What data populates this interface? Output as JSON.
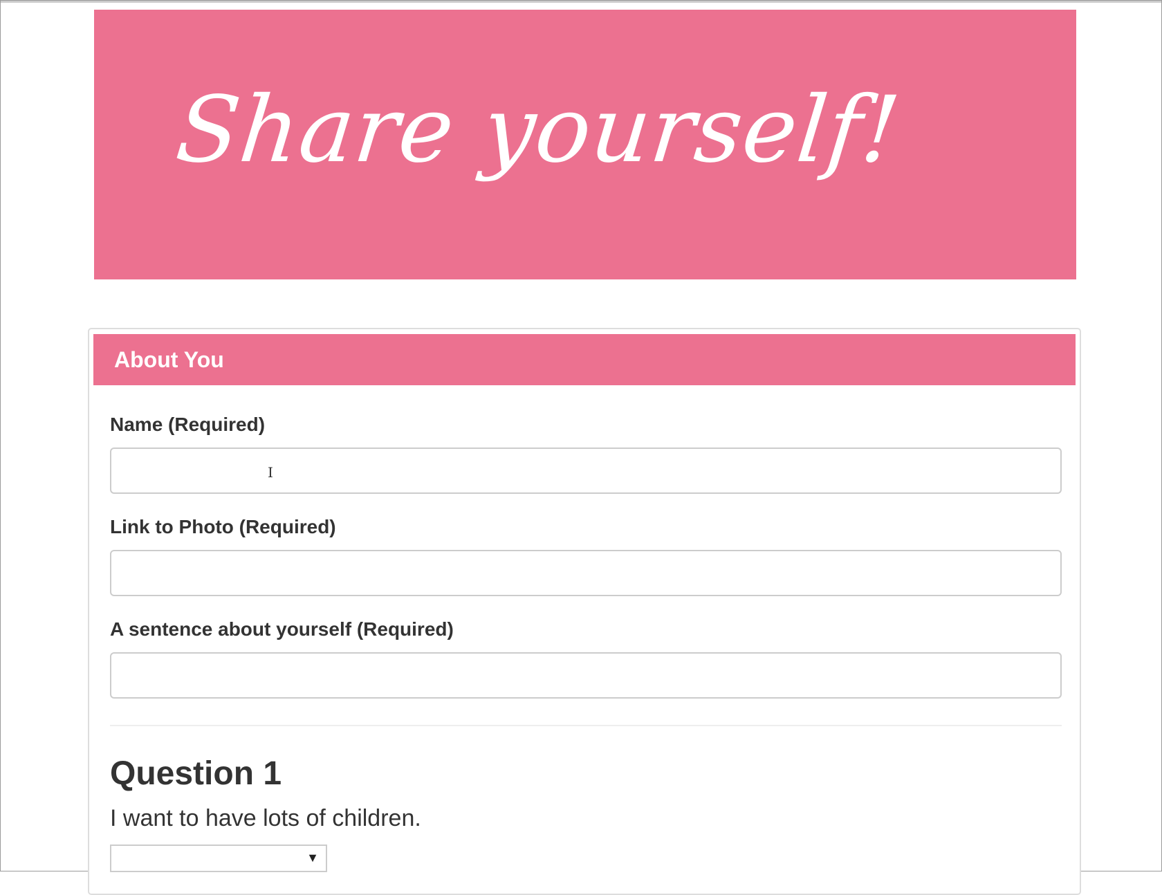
{
  "hero": {
    "title": "Share yourself!"
  },
  "section": {
    "heading": "About You"
  },
  "fields": {
    "name": {
      "label": "Name (Required)",
      "value": ""
    },
    "photo": {
      "label": "Link to Photo (Required)",
      "value": ""
    },
    "sentence": {
      "label": "A sentence about yourself (Required)",
      "value": ""
    }
  },
  "question1": {
    "heading": "Question 1",
    "text": "I want to have lots of children.",
    "selected": "",
    "arrow": "▼"
  },
  "colors": {
    "accent": "#ec7190",
    "text": "#333333",
    "border": "#cccccc"
  },
  "icons": {
    "text_cursor": "text-cursor-icon",
    "dropdown": "chevron-down-icon"
  }
}
